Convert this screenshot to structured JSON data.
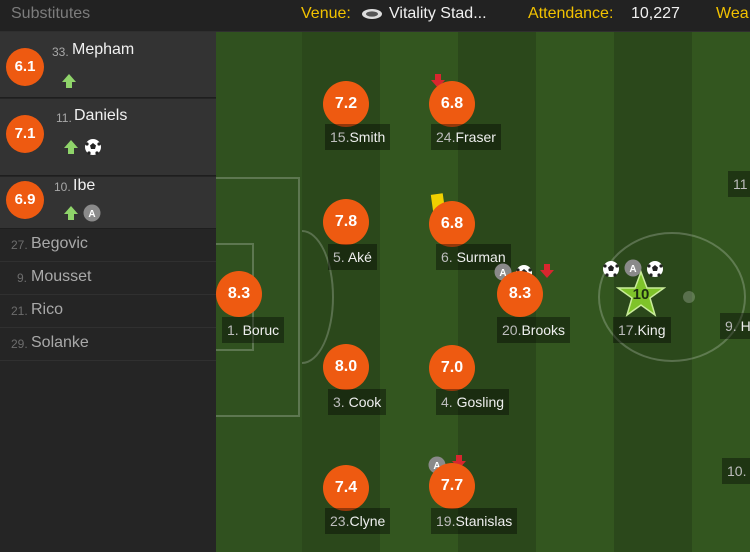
{
  "header": {
    "substitutes_title": "Substitutes",
    "venue_label": "Venue:",
    "venue_value": "Vitality Stad...",
    "attendance_label": "Attendance:",
    "attendance_value": "10,227",
    "weather_label": "Wea"
  },
  "substitutes": [
    {
      "rating": "6.1",
      "number": "33.",
      "name": "Mepham",
      "events": [
        "sub-on-arrow-icon"
      ]
    },
    {
      "rating": "7.1",
      "number": "11.",
      "name": "Daniels",
      "events": [
        "sub-on-arrow-icon",
        "goal-ball-icon"
      ]
    },
    {
      "rating": "6.9",
      "number": "10.",
      "name": "Ibe",
      "events": [
        "sub-on-arrow-icon",
        "assist-icon"
      ]
    }
  ],
  "unused_subs": [
    {
      "number": "27.",
      "name": "Begovic"
    },
    {
      "number": "9.",
      "name": "Mousset"
    },
    {
      "number": "21.",
      "name": "Rico"
    },
    {
      "number": "29.",
      "name": "Solanke"
    }
  ],
  "players": [
    {
      "rating": "8.3",
      "number": "1.",
      "name": "Boruc"
    },
    {
      "rating": "7.2",
      "number": "15.",
      "name": "Smith"
    },
    {
      "rating": "6.8",
      "number": "24.",
      "name": "Fraser",
      "events": [
        "sub-off-arrow-icon"
      ]
    },
    {
      "rating": "7.8",
      "number": "5.",
      "name": "Aké"
    },
    {
      "rating": "6.8",
      "number": "6.",
      "name": "Surman",
      "events": [
        "yellow-card-icon"
      ]
    },
    {
      "rating": "8.3",
      "number": "20.",
      "name": "Brooks",
      "events": [
        "assist-icon",
        "goal-ball-icon",
        "sub-off-arrow-icon"
      ]
    },
    {
      "rating": "10",
      "number": "17.",
      "name": "King",
      "events": [
        "goal-ball-icon",
        "assist-icon",
        "goal-ball-icon"
      ],
      "man_of_match": true
    },
    {
      "rating": "8.0",
      "number": "3.",
      "name": "Cook"
    },
    {
      "rating": "7.0",
      "number": "4.",
      "name": "Gosling"
    },
    {
      "rating": "7.4",
      "number": "23.",
      "name": "Clyne"
    },
    {
      "rating": "7.7",
      "number": "19.",
      "name": "Stanislas",
      "events": [
        "assist-icon",
        "sub-off-arrow-icon"
      ]
    }
  ],
  "opponents_partial": [
    {
      "number": "11"
    },
    {
      "number": "9.",
      "name": "H"
    },
    {
      "number": "10."
    }
  ],
  "colors": {
    "rating": "#ee5a11",
    "pitch_dark": "#2c4a1c",
    "pitch_light": "#355822",
    "star": "#7fc32a",
    "accent": "#f2c200"
  }
}
